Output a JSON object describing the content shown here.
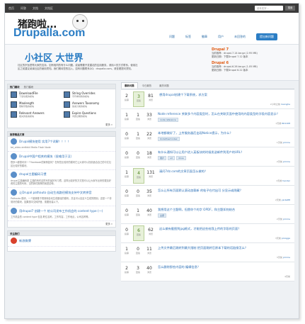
{
  "topbar": {
    "links": [
      "首页",
      "问答",
      "文档",
      "文档区"
    ],
    "search_placeholder": "站长名字...",
    "search_button": "搜索"
  },
  "header": {
    "logo_cn": "猪跑啦...",
    "logo_en": "Drupalla.com",
    "nav": [
      "问题",
      "标签",
      "徽章",
      "用户",
      "未回答的"
    ],
    "cta": "提出新问题"
  },
  "banner": {
    "slogan": "小社区 大世界",
    "description": "社区的宗旨是帮大家的支持。如有相同的有什么问题。或者需要开发建站的应用服务。请用人的方式联系。使用社区之前建议阅读社区的使用须知。我们期待您的加入。如有问题联系QQ：drupalla.com。请查看提问须知。"
  },
  "releases": [
    {
      "title": "Drupal 7",
      "lines": [
        "当前推荐：drupal-7.14.tar.gz (2.95 MB)",
        "更新日期：下载Drupal 7.12 版本"
      ]
    },
    {
      "title": "Drupal 6",
      "lines": [
        "当前推荐：drupal-6.26.tar.gz (1.05 MB)",
        "更新日期：下载Drupal 6.22 版本"
      ]
    }
  ],
  "projects_panel": {
    "tabs": [
      "热门模块",
      "热门模块"
    ],
    "items": [
      {
        "title": "DownloadFile",
        "sub": "下载功能的模块"
      },
      {
        "title": "String Overrides",
        "sub": "字符串替换的模块"
      },
      {
        "title": "Maxlength",
        "sub": "限制字数的模块"
      },
      {
        "title": "Answers Taxonomy",
        "sub": "答案分类的模块"
      },
      {
        "title": "Relevant Answers",
        "sub": "相关的答案模块"
      },
      {
        "title": "Expire Questions",
        "sub": "问题过期的模块"
      }
    ],
    "more": "更多 »"
  },
  "articles_panel": {
    "title": "推荐精品文章",
    "items": [
      {
        "title": "Drupal模块使用 实用7个详解！！！！",
        "sub": "bd_video emfield Media   Flash Node"
      },
      {
        "title": "Drupal中国产相关的模块（很难用于汉）",
        "sub": "很多人都想问问一个facebook的案例如何？在有些比较好的模块它让大家可以找到适合自己的中文社区比较好的模块。"
      },
      {
        "title": "drupal主题编码习惯",
        "sub": "drupal主题编码是 主题的有时这样写的最好写习惯。这样比较好的方式是可以让大家写出来的更加好看的主题的代码，当然我们推荐的就是这种。"
      },
      {
        "title": "让Drupal pathauto 自动生成路径模块支持中文转拼音",
        "sub": "Pathauto 模块，一个能够基于规则而自动生成路径的模块。并且可以自定义生成的规则。这是一个非常好的模块，如果想中文转拼音，需要安装以下。"
      },
      {
        "title": "用drupal7 创建一个 给公司发布工作机会的 content type (一)",
        "sub": "工作机会的 content type 包括 职位名称，工作内容，工作地点，公司名称等。"
      }
    ],
    "more": "更多 »"
  },
  "follow_panel": {
    "title": "关注我们",
    "weibo": "新浪微博"
  },
  "question_tabs": [
    "最新问题",
    "今日最热",
    "最热问题"
  ],
  "labels": {
    "votes": "投票",
    "answers": "回答",
    "views": "浏览"
  },
  "questions": [
    {
      "votes": "2",
      "answers": "3",
      "views": "81",
      "answered": true,
      "title": "想用drupal创建个下载系统，求方案",
      "tags": [],
      "meta": "2小时之前",
      "user": "duonghe"
    },
    {
      "votes": "1",
      "answers": "1",
      "views": "33",
      "answered": false,
      "title": "Node reference 关联多个内容类型时，怎么在关联页面中使用的内容类型的字段内容显示？",
      "tags": [
        "node reference"
      ],
      "meta": "1天前",
      "user": "RK1108"
    },
    {
      "votes": "0",
      "answers": "1",
      "views": "22",
      "answered": false,
      "title": "本地都做好了，上传服务器后出现Notice提示，为什么？",
      "tags": [
        "Undefined index"
      ],
      "meta": "1天前",
      "user": "jcmme"
    },
    {
      "votes": "0",
      "answers": "0",
      "views": "18",
      "answered": false,
      "title": "有什么通知可以让用户进入某板块的时候发送邮件到用户的URL？",
      "tags": [
        "用户",
        "url",
        "drive"
      ],
      "meta": "2天前",
      "user": "jcmme"
    },
    {
      "votes": "1",
      "answers": "4",
      "views": "131",
      "answered": true,
      "title": "请问7dz.com的文章页面怎么做的？",
      "tags": [],
      "meta": "2天前",
      "user": "hender"
    },
    {
      "votes": "0",
      "answers": "0",
      "views": "35",
      "answered": false,
      "title": "怎么让所有页面默认滚动加载新 的帖子在付出可 分显示或隐藏？",
      "tags": [],
      "meta": "2天前",
      "user": "yarke88"
    },
    {
      "votes": "0",
      "answers": "1",
      "views": "40",
      "answered": false,
      "title": "我想用这个主题啊，但愿你个的字 OPDF，和主题如何结合",
      "tags": [
        "主题"
      ],
      "meta": "2天前",
      "user": "jcmme"
    },
    {
      "votes": "0",
      "answers": "6",
      "views": "62",
      "answered": true,
      "title": "这么做有截图到jpg格式，才能把这些给我上传的字段的页面？",
      "tags": [],
      "meta": "3天前",
      "user": "pinogga"
    },
    {
      "votes": "1",
      "answers": "0",
      "views": "11",
      "answered": false,
      "title": "上传文件最后跳转到最大限制 把页面跳转后原本下载的话链接怎么？",
      "tags": [],
      "meta": "3天前",
      "user": "jcmme"
    },
    {
      "votes": "2",
      "answers": "3",
      "views": "40",
      "answered": false,
      "title": "怎么删除那些内容的 编辑信息？",
      "tags": [],
      "meta": "4天前",
      "user": ""
    }
  ]
}
